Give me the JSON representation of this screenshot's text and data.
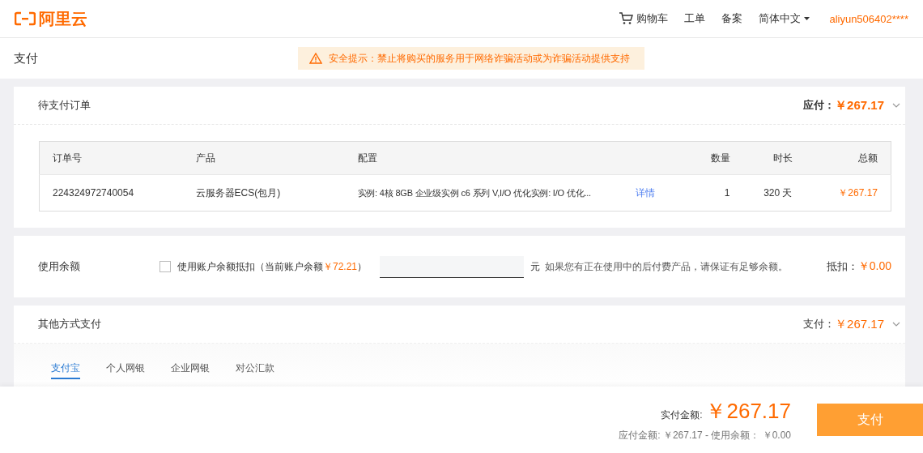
{
  "header": {
    "logo_text": "阿里云",
    "cart": "购物车",
    "links": [
      "工单",
      "备案"
    ],
    "language": "简体中文",
    "user": "aliyun506402****"
  },
  "page": {
    "title": "支付",
    "warning": "安全提示：禁止将购买的服务用于网络诈骗活动或为诈骗活动提供支持"
  },
  "orders": {
    "title": "待支付订单",
    "due_label": "应付：",
    "due_amount": "￥267.17",
    "columns": [
      "订单号",
      "产品",
      "配置",
      "数量",
      "时长",
      "总额"
    ],
    "rows": [
      {
        "order_no": "224324972740054",
        "product": "云服务器ECS(包月)",
        "config": "实例: 4核 8GB 企业级实例 c6 系列 V,I/O 优化实例: I/O 优化...",
        "detail_link": "详情",
        "quantity": "1",
        "duration": "320 天",
        "total": "￥267.17"
      }
    ]
  },
  "balance": {
    "title": "使用余额",
    "checked": false,
    "label": "使用账户余额抵扣（当前账户余额",
    "amount": "￥72.21",
    "label_end": "）",
    "unit": "元",
    "hint": "如果您有正在使用中的后付费产品，请保证有足够余额。",
    "deduct_label": "抵扣：",
    "deduct_amount": "￥0.00"
  },
  "other": {
    "title": "其他方式支付",
    "pay_label": "支付：",
    "pay_amount": "￥267.17",
    "tabs": [
      {
        "label": "支付宝",
        "selected": true
      },
      {
        "label": "个人网银",
        "selected": false
      },
      {
        "label": "企业网银",
        "selected": false
      },
      {
        "label": "对公汇款",
        "selected": false
      }
    ]
  },
  "footer": {
    "actual_label": "实付金额:",
    "actual_amount": "￥267.17",
    "breakdown": "应付金额: ￥267.17 - 使用余额： ￥0.00",
    "pay_button": "支付"
  }
}
